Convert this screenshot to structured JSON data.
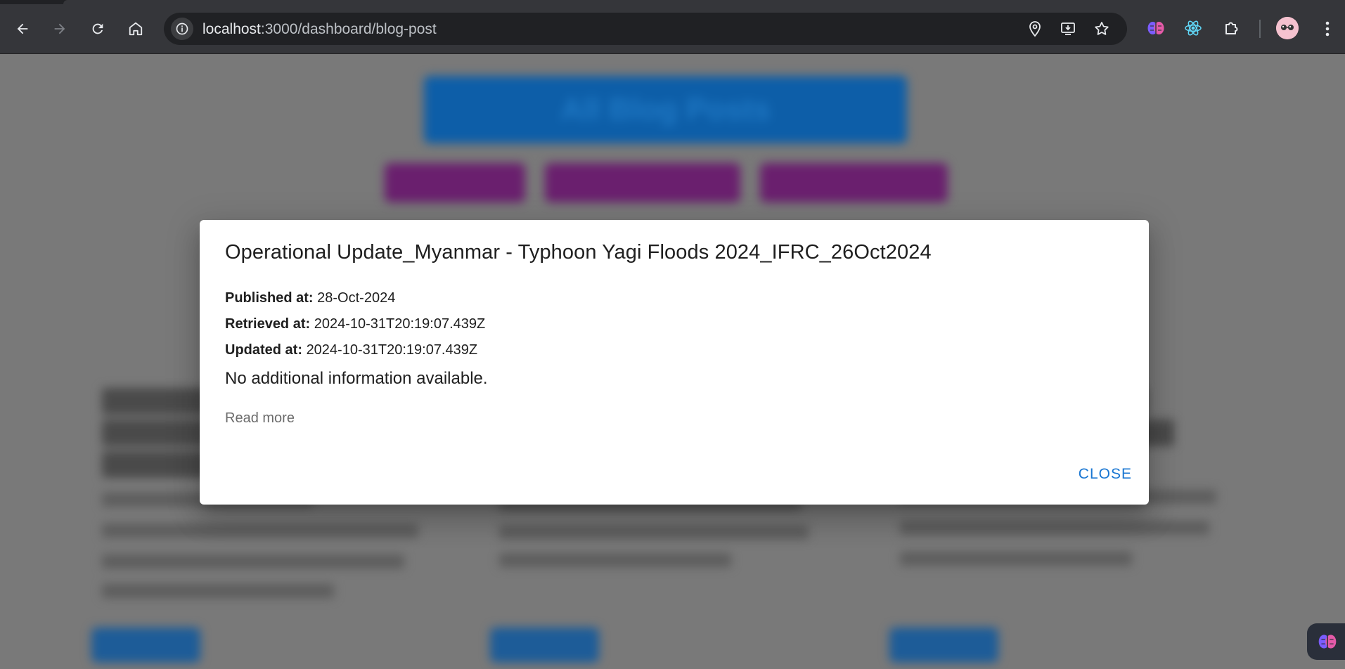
{
  "browser": {
    "url_host": "localhost",
    "url_path": ":3000/dashboard/blog-post",
    "accent": "#35363a"
  },
  "background_page": {
    "header_text": "All Blog Posts"
  },
  "modal": {
    "title": "Operational Update_Myanmar - Typhoon Yagi Floods 2024_IFRC_26Oct2024",
    "published_label": "Published at:",
    "published_value": "28-Oct-2024",
    "retrieved_label": "Retrieved at:",
    "retrieved_value": "2024-10-31T20:19:07.439Z",
    "updated_label": "Updated at:",
    "updated_value": "2024-10-31T20:19:07.439Z",
    "description": "No additional information available.",
    "read_more": "Read more",
    "close_label": "CLOSE",
    "close_color": "#1976d2"
  },
  "icons": {
    "back": "arrow-left-icon",
    "forward": "arrow-right-icon",
    "reload": "reload-icon",
    "home": "home-icon",
    "site_info": "info-icon",
    "location": "location-pin-icon",
    "install": "install-app-icon",
    "bookmark": "star-icon",
    "ext_brain": "brain-icon",
    "ext_react": "react-icon",
    "extensions": "puzzle-icon",
    "menu": "kebab-menu-icon"
  }
}
